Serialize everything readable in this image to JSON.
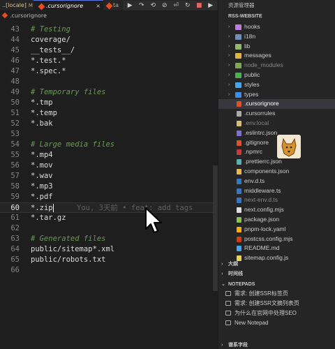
{
  "tabs": [
    {
      "label": "..[locale]",
      "badge": "M"
    },
    {
      "label": ".cursorignore",
      "close": "×"
    },
    {
      "label": "ta"
    }
  ],
  "debug": [
    "▶",
    "↷",
    "⟲",
    "⊘",
    "⏎",
    "↻",
    "■",
    "▶"
  ],
  "breadcrumb": ".cursorignore",
  "editor": {
    "lines": [
      {
        "n": "43",
        "text": "# Testing",
        "comment": true
      },
      {
        "n": "44",
        "text": "coverage/"
      },
      {
        "n": "45",
        "text": "__tests__/"
      },
      {
        "n": "46",
        "text": "*.test.*"
      },
      {
        "n": "47",
        "text": "*.spec.*"
      },
      {
        "n": "48",
        "text": ""
      },
      {
        "n": "49",
        "text": "# Temporary files",
        "comment": true
      },
      {
        "n": "50",
        "text": "*.tmp"
      },
      {
        "n": "51",
        "text": "*.temp"
      },
      {
        "n": "52",
        "text": "*.bak"
      },
      {
        "n": "53",
        "text": ""
      },
      {
        "n": "54",
        "text": "# Large media files",
        "comment": true
      },
      {
        "n": "55",
        "text": "*.mp4"
      },
      {
        "n": "56",
        "text": "*.mov"
      },
      {
        "n": "57",
        "text": "*.wav"
      },
      {
        "n": "58",
        "text": "*.mp3"
      },
      {
        "n": "59",
        "text": "*.pdf"
      },
      {
        "n": "60",
        "text": "*.zip",
        "active": true,
        "blame": "You, 3天前 • feat: add tags"
      },
      {
        "n": "61",
        "text": "*.tar.gz"
      },
      {
        "n": "62",
        "text": ""
      },
      {
        "n": "63",
        "text": "# Generated files",
        "comment": true
      },
      {
        "n": "64",
        "text": "public/sitemap*.xml"
      },
      {
        "n": "65",
        "text": "public/robots.txt"
      },
      {
        "n": "66",
        "text": ""
      }
    ]
  },
  "sidebar": {
    "title": "资源管理器",
    "project": "RSS-WEBSITE",
    "items": [
      {
        "name": "hooks",
        "folder": true,
        "color": "#c07be0",
        "text": "#ccc"
      },
      {
        "name": "i18n",
        "folder": true,
        "color": "#6e8fbf",
        "text": "#ccc"
      },
      {
        "name": "lib",
        "folder": true,
        "color": "#8fb86a",
        "text": "#ccc"
      },
      {
        "name": "messages",
        "folder": true,
        "color": "#e3b341",
        "text": "#ccc"
      },
      {
        "name": "node_modules",
        "folder": true,
        "color": "#7fa650",
        "text": "#888"
      },
      {
        "name": "public",
        "folder": true,
        "color": "#4caf50",
        "text": "#ccc"
      },
      {
        "name": "styles",
        "folder": true,
        "color": "#42a5f5",
        "text": "#ccc"
      },
      {
        "name": "types",
        "folder": true,
        "color": "#3b8ee8",
        "text": "#ccc"
      },
      {
        "name": ".cursorignore",
        "color": "#e44d26",
        "text": "#fff",
        "selected": true
      },
      {
        "name": ".cursorrules",
        "color": "#aaaaaa",
        "text": "#ccc"
      },
      {
        "name": ".env.local",
        "color": "#d8c070",
        "text": "#888"
      },
      {
        "name": ".eslintrc.json",
        "color": "#7b6fd6",
        "text": "#ccc"
      },
      {
        "name": ".gitignore",
        "color": "#e44d26",
        "text": "#ccc"
      },
      {
        "name": ".npmrc",
        "color": "#cb3837",
        "text": "#ccc"
      },
      {
        "name": ".prettierrc.json",
        "color": "#56b3b4",
        "text": "#ccc"
      },
      {
        "name": "components.json",
        "color": "#e8b84a",
        "text": "#ccc"
      },
      {
        "name": "env.d.ts",
        "color": "#3178c6",
        "text": "#ccc"
      },
      {
        "name": "middleware.ts",
        "color": "#3178c6",
        "text": "#ccc"
      },
      {
        "name": "next-env.d.ts",
        "color": "#3178c6",
        "text": "#888"
      },
      {
        "name": "next.config.mjs",
        "color": "#dddddd",
        "text": "#ccc"
      },
      {
        "name": "package.json",
        "color": "#8bc34a",
        "text": "#ccc"
      },
      {
        "name": "pnpm-lock.yaml",
        "color": "#f9ad00",
        "text": "#ccc"
      },
      {
        "name": "postcss.config.mjs",
        "color": "#dd3a0a",
        "text": "#ccc"
      },
      {
        "name": "README.md",
        "color": "#42a5f5",
        "text": "#ccc"
      },
      {
        "name": "sitemap.config.js",
        "color": "#e8d44d",
        "text": "#ccc"
      }
    ],
    "sections": [
      "大纲",
      "时间线",
      "NOTEPADS",
      "谱系字段"
    ],
    "notepads": [
      "需求: 创建SSR标签页",
      "需求: 创建SSR文摘列表页",
      "为什么在官网中处理SEO",
      "New Notepad"
    ]
  }
}
